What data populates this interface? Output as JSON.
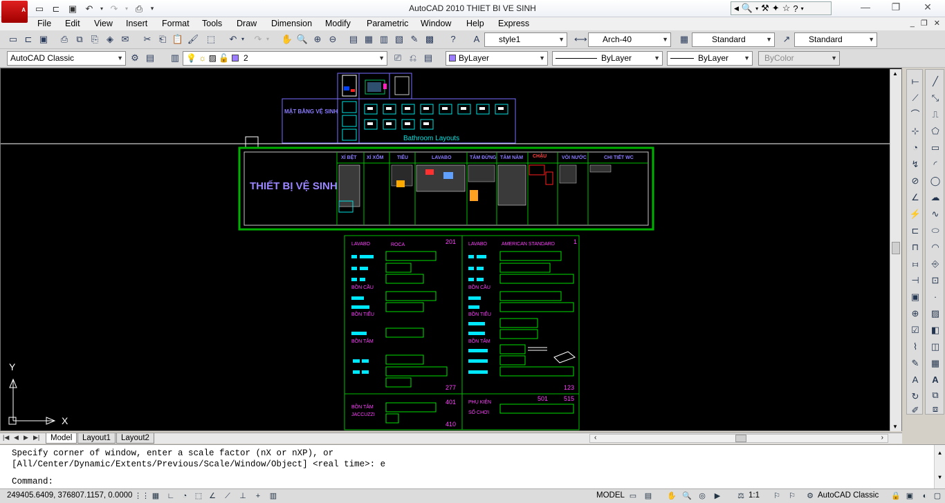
{
  "window": {
    "title": "AutoCAD 2010      THIET BI VE SINH",
    "app_logo": "A"
  },
  "menu": [
    "File",
    "Edit",
    "View",
    "Insert",
    "Format",
    "Tools",
    "Draw",
    "Dimension",
    "Modify",
    "Parametric",
    "Window",
    "Help",
    "Express"
  ],
  "toolbar": {
    "text_style": "style1",
    "dim_style": "Arch-40",
    "table_style": "Standard",
    "multileader_style": "Standard",
    "workspace": "AutoCAD Classic",
    "layer": "2",
    "color": "ByLayer",
    "linetype": "ByLayer",
    "lineweight": "ByLayer",
    "plotstyle": "ByColor"
  },
  "drawing": {
    "top_block_label": "MẶT BẰNG VỆ SINH",
    "top_block_caption": "Bathroom Layouts",
    "main_title": "THIẾT BỊ VỆ SINH",
    "columns": [
      "XÍ BỆT",
      "XÍ XỔM",
      "TIỂU",
      "LAVABO",
      "TẮM ĐỨNG",
      "TẮM NẰM",
      "CHẬU",
      "VÒI NƯỚC",
      "CHI TIẾT WC"
    ],
    "sheet_left": {
      "header": "LAVABO",
      "brand": "ROCA",
      "number_top": "201",
      "sections": [
        "BỒN CẦU",
        "BỒN TIỂU",
        "BỒN TẮM"
      ],
      "number_bottom": "277",
      "jacuzzi_label": "BỒN TẮM",
      "jacuzzi_label2": "JACCUZZI",
      "number_j1": "401",
      "number_j2": "410"
    },
    "sheet_right": {
      "header": "LAVABO",
      "brand": "AMERICAN STANDARD",
      "number_top": "1",
      "sections": [
        "BỒN CẦU",
        "BỒN TIỂU",
        "BỒN TẮM"
      ],
      "number_bottom": "123",
      "accessories_label": "PHỤ KIỆN",
      "accessories_label2": "SỐ CHƠI",
      "number_a1": "501",
      "number_a2": "515"
    },
    "ucs_y": "Y",
    "ucs_x": "X"
  },
  "tabs": [
    "Model",
    "Layout1",
    "Layout2"
  ],
  "command": {
    "line1": "Specify corner of window, enter a scale factor (nX or nXP), or",
    "line2": "[All/Center/Dynamic/Extents/Previous/Scale/Window/Object] <real time>: e",
    "prompt": "Command:"
  },
  "status": {
    "coordinates": "249405.6409, 376807.1157, 0.0000",
    "space": "MODEL",
    "annotation_scale": "1:1",
    "workspace": "AutoCAD Classic"
  }
}
